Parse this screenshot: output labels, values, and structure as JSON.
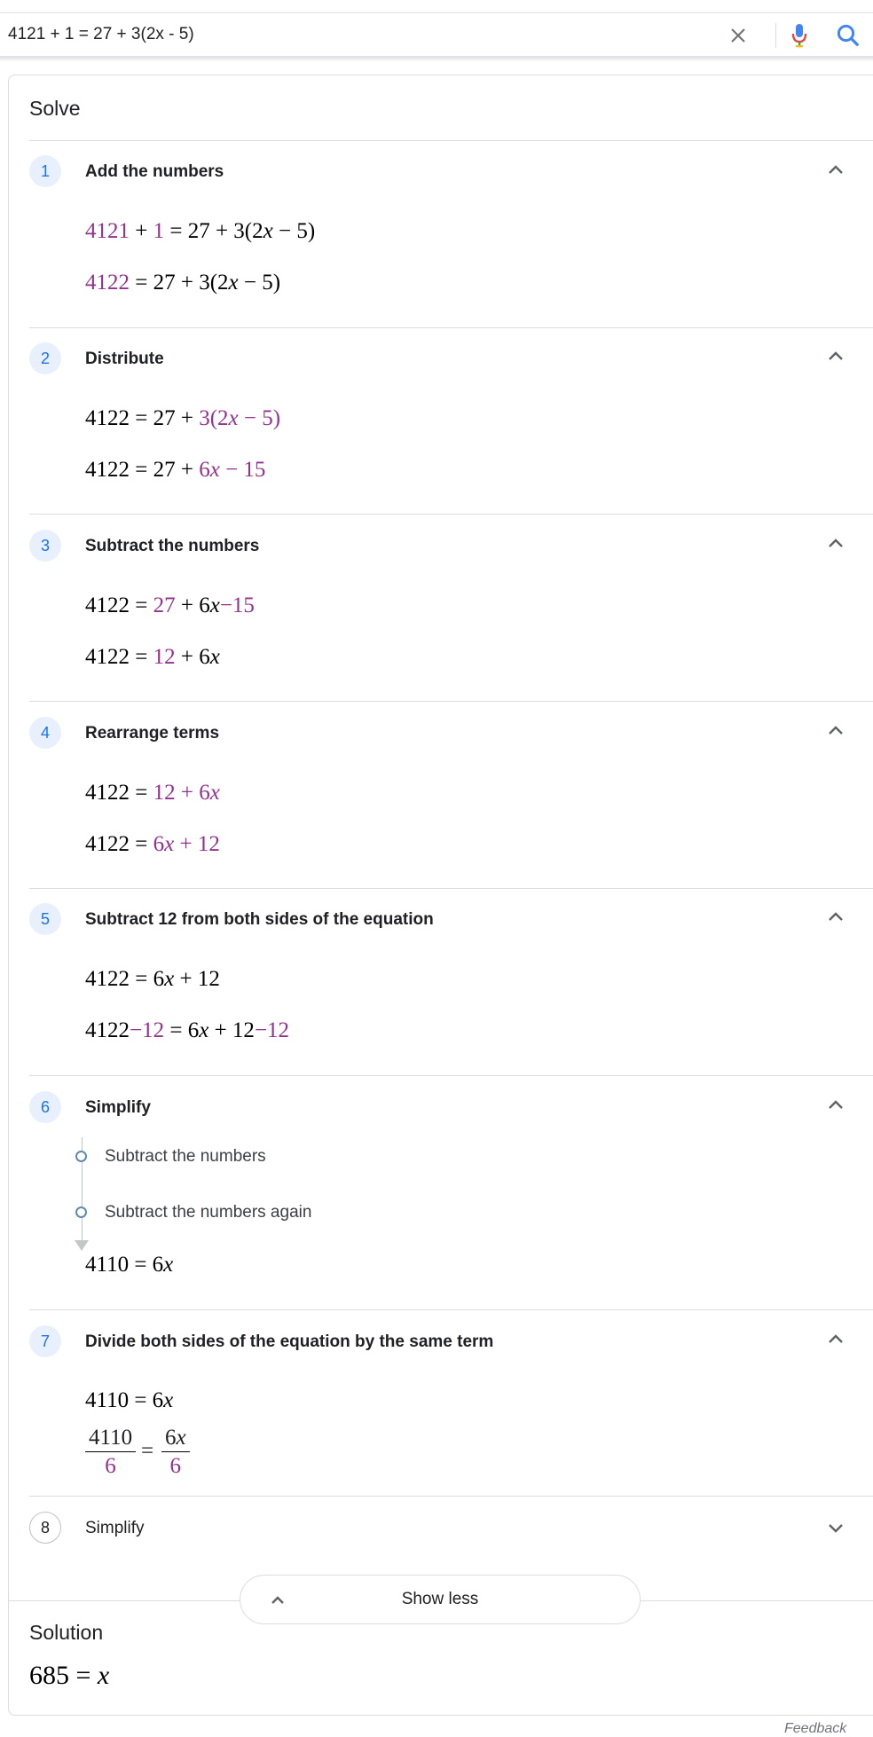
{
  "search": {
    "query": "4121 + 1 = 27 + 3(2x - 5)"
  },
  "solve": {
    "title": "Solve"
  },
  "steps": [
    {
      "num": "1",
      "title": "Add the numbers"
    },
    {
      "num": "2",
      "title": "Distribute"
    },
    {
      "num": "3",
      "title": "Subtract the numbers"
    },
    {
      "num": "4",
      "title": "Rearrange terms"
    },
    {
      "num": "5",
      "title": "Subtract 12 from both sides of the equation"
    },
    {
      "num": "6",
      "title": "Simplify"
    },
    {
      "num": "7",
      "title": "Divide both sides of the equation by the same term"
    },
    {
      "num": "8",
      "title": "Simplify"
    }
  ],
  "math": {
    "s1a": {
      "a": "4121",
      "b": " + ",
      "c": "1",
      "d": " = 27 + 3(2",
      "x": "x",
      "e": " − 5)"
    },
    "s1b": {
      "a": "4122",
      "b": " = 27 + 3(2",
      "x": "x",
      "c": " − 5)"
    },
    "s2a": {
      "a": "4122 = 27 + ",
      "b": "3(2",
      "x": "x",
      "c": " − 5)"
    },
    "s2b": {
      "a": "4122 = 27 + ",
      "b": "6",
      "x": "x",
      "c": " − 15"
    },
    "s3a": {
      "a": "4122 = ",
      "b": "27",
      "c": " + 6",
      "x": "x",
      "d": "−15"
    },
    "s3b": {
      "a": "4122 = ",
      "b": "12",
      "c": " + 6",
      "x": "x"
    },
    "s4a": {
      "a": "4122 = ",
      "b": "12 + 6",
      "x": "x"
    },
    "s4b": {
      "a": "4122 = ",
      "b": "6",
      "x": "x",
      "c": " + 12"
    },
    "s5a": {
      "a": "4122 = 6",
      "x": "x",
      "b": " + 12"
    },
    "s5b": {
      "a": "4122",
      "b": "−12",
      "c": " = 6",
      "x": "x",
      "d": " + 12",
      "e": "−12"
    },
    "s6": {
      "a": "4110 = 6",
      "x": "x"
    },
    "s7a": {
      "a": "4110 = 6",
      "x": "x"
    },
    "s7frac": {
      "lnum": "4110",
      "lden": "6",
      "eq": "=",
      "rnum": "6",
      "rx": "x",
      "rden": "6"
    }
  },
  "simplify_substeps": [
    "Subtract the numbers",
    "Subtract the numbers again"
  ],
  "show_less": {
    "label": "Show less"
  },
  "solution": {
    "title": "Solution",
    "a": "685 = ",
    "x": "x"
  },
  "footer": {
    "feedback": "Feedback"
  },
  "colors": {
    "highlight": "#93318f",
    "step_badge_bg": "#e8f0fe",
    "step_badge_text": "#1a73e8"
  },
  "icons": {
    "clear": "close-icon",
    "voice": "microphone-icon",
    "search": "search-icon",
    "collapse": "chevron-up-icon",
    "expand": "chevron-down-icon"
  }
}
